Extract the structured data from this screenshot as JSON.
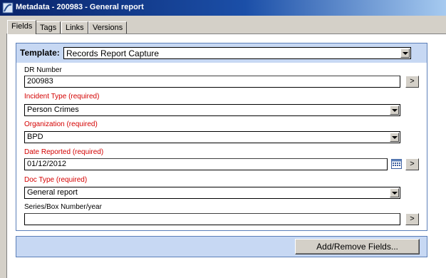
{
  "window": {
    "title": "Metadata - 200983 - General report"
  },
  "tabs": [
    {
      "label": "Fields",
      "active": true
    },
    {
      "label": "Tags"
    },
    {
      "label": "Links"
    },
    {
      "label": "Versions"
    }
  ],
  "form": {
    "template_label": "Template:",
    "template_value": "Records Report Capture",
    "fields": [
      {
        "label": "DR Number",
        "value": "200983",
        "type": "text",
        "required": false
      },
      {
        "label": "Incident Type (required)",
        "value": "Person Crimes",
        "type": "select",
        "required": true
      },
      {
        "label": "Organization (required)",
        "value": "BPD",
        "type": "select",
        "required": true
      },
      {
        "label": "Date Reported (required)",
        "value": "01/12/2012",
        "type": "date",
        "required": true
      },
      {
        "label": "Doc Type (required)",
        "value": "General report",
        "type": "select",
        "required": true
      },
      {
        "label": "Series/Box Number/year",
        "value": "",
        "type": "text",
        "required": false
      }
    ],
    "go_button_label": ">",
    "add_remove_button_label": "Add/Remove Fields..."
  },
  "colors": {
    "required_label": "#d40000",
    "panel_accent": "#c7d8f3",
    "title_gradient_start": "#0a246a"
  }
}
